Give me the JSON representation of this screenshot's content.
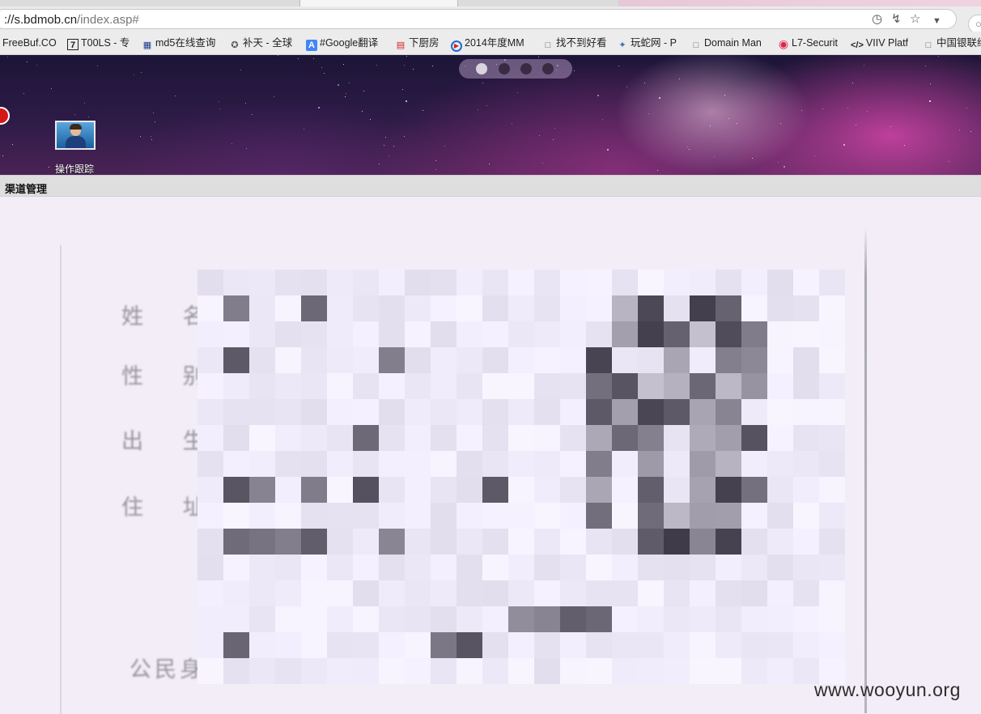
{
  "browser": {
    "url_prefix": "://s.bdmob.cn",
    "url_path": "/index.asp#",
    "bookmarks": [
      {
        "label": "FreeBuf.CO",
        "icon": "none"
      },
      {
        "label": "T00LS - 专",
        "icon": "tools-icon"
      },
      {
        "label": "md5在线查询",
        "icon": "grid-icon"
      },
      {
        "label": "补天 - 全球",
        "icon": "butian-icon"
      },
      {
        "label": "#Google翻译",
        "icon": "translate-icon"
      },
      {
        "label": "下厨房",
        "icon": "xiachufang-icon"
      },
      {
        "label": "2014年度MM",
        "icon": "play-icon"
      },
      {
        "label": "找不到好看",
        "icon": "page-icon"
      },
      {
        "label": "玩蛇网 - P",
        "icon": "python-icon"
      },
      {
        "label": "Domain Man",
        "icon": "page-icon"
      },
      {
        "label": "L7-Securit",
        "icon": "l7-icon"
      },
      {
        "label": "VIIV Platf",
        "icon": "code-icon"
      },
      {
        "label": "中国银联绪",
        "icon": "page-icon"
      }
    ]
  },
  "header": {
    "pager_dots": 4,
    "active_dot": 0,
    "desktop_icon_label": "操作跟踪"
  },
  "section": {
    "title": "渠道管理"
  },
  "document": {
    "field_labels": [
      "姓 名",
      "性 别",
      "出 生",
      "住 址",
      "公民身"
    ]
  },
  "watermark": "www.wooyun.org",
  "colors": {
    "bookmark_bar": "#ececec",
    "section_bar": "#dedede",
    "paper": "#f2edf6"
  }
}
